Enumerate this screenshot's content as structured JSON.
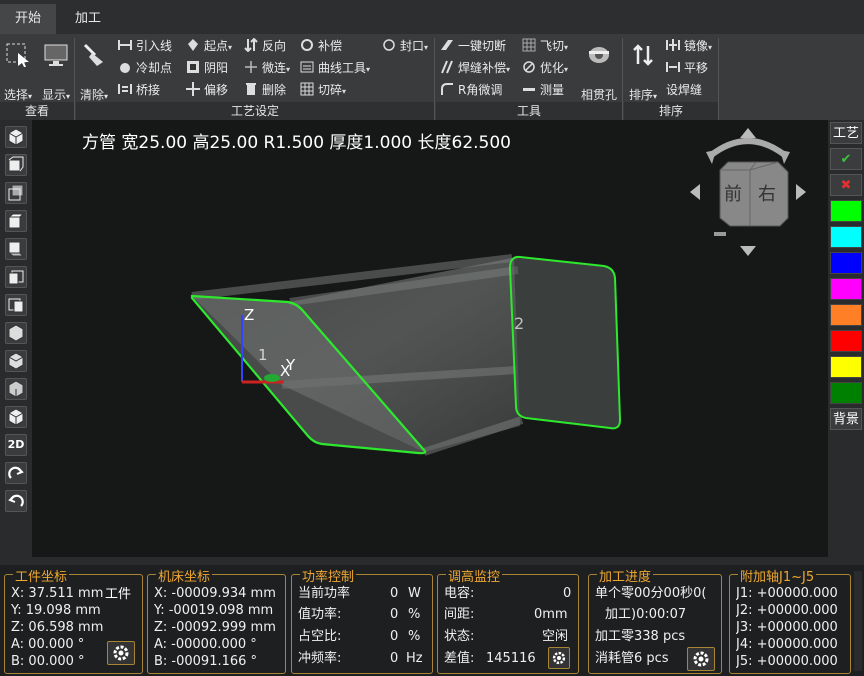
{
  "menu": {
    "tabs": [
      "开始",
      "加工"
    ]
  },
  "ribbon": {
    "groups": {
      "view": "查看",
      "process": "工艺设定",
      "tools": "工具",
      "sort": "排序"
    },
    "big": {
      "select": "选择",
      "display": "显示",
      "clear": "清除",
      "pierce": "相贯孔",
      "sort": "排序"
    },
    "small": {
      "lead": "引入线",
      "cool": "冷却点",
      "bridge": "桥接",
      "start": "起点",
      "yinyang": "阴阳",
      "offset": "偏移",
      "reverse": "反向",
      "micro": "微连",
      "delete": "删除",
      "compensate": "补偿",
      "curve": "曲线工具",
      "cut": "切碎",
      "seal": "封口",
      "onecut": "一键切断",
      "weldcomp": "焊缝补偿",
      "rcorner": "R角微调",
      "flycut": "飞切",
      "optimize": "优化",
      "measure": "测量",
      "mirror": "镜像",
      "translate": "平移",
      "setweld": "设焊缝"
    }
  },
  "viewport": {
    "info": "方管 宽25.00 高25.00 R1.500 厚度1.000 长度62.500",
    "label1": "1",
    "label2": "2",
    "axis_x": "X",
    "axis_y": "Y",
    "axis_z": "Z",
    "cube_front": "前",
    "cube_right": "右",
    "left_2d": "2D"
  },
  "right_palette": {
    "process": "工艺",
    "background": "背景",
    "colors": [
      "#00ff00",
      "#00ffff",
      "#0000ff",
      "#ff00ff",
      "#ff7f27",
      "#ff0000",
      "#ffff00",
      "#008000"
    ]
  },
  "panels": {
    "workpiece": {
      "title": "工件坐标",
      "x": "X: 37.511 mm",
      "y": "Y: 19.098 mm",
      "z": "Z: 06.598 mm",
      "a": "A: 00.000 °",
      "b": "B: 00.000 °",
      "mode": "工件"
    },
    "machine": {
      "title": "机床坐标",
      "x": "X: -00009.934 mm",
      "y": "Y: -00019.098 mm",
      "z": "Z: -00092.999 mm",
      "a": "A: -00000.000 °",
      "b": "B: -00091.166 °"
    },
    "power": {
      "title": "功率控制",
      "r1_label": "当前功率",
      "r1_val": "0",
      "r1_unit": "W",
      "r2_label": "值功率:",
      "r2_val": "0",
      "r2_unit": "%",
      "r3_label": "占空比:",
      "r3_val": "0",
      "r3_unit": "%",
      "r4_label": "冲频率:",
      "r4_val": "0",
      "r4_unit": "Hz"
    },
    "height": {
      "title": "调高监控",
      "r1_label": "电容:",
      "r1_val": "0",
      "r2_label": "间距:",
      "r2_val": "0mm",
      "r3_label": "状态:",
      "r3_val": "空闲",
      "r4_label": "差值:",
      "r4_val": "145116"
    },
    "progress": {
      "title": "加工进度",
      "r1": "单个零00分00秒0(",
      "r2": "加工)0:00:07",
      "r3": "加工零338 pcs",
      "r4": "消耗管6 pcs"
    },
    "aux": {
      "title": "附加轴J1~J5",
      "j1": "J1: +00000.000",
      "j2": "J2: +00000.000",
      "j3": "J3: +00000.000",
      "j4": "J4: +00000.000",
      "j5": "J5: +00000.000"
    }
  }
}
